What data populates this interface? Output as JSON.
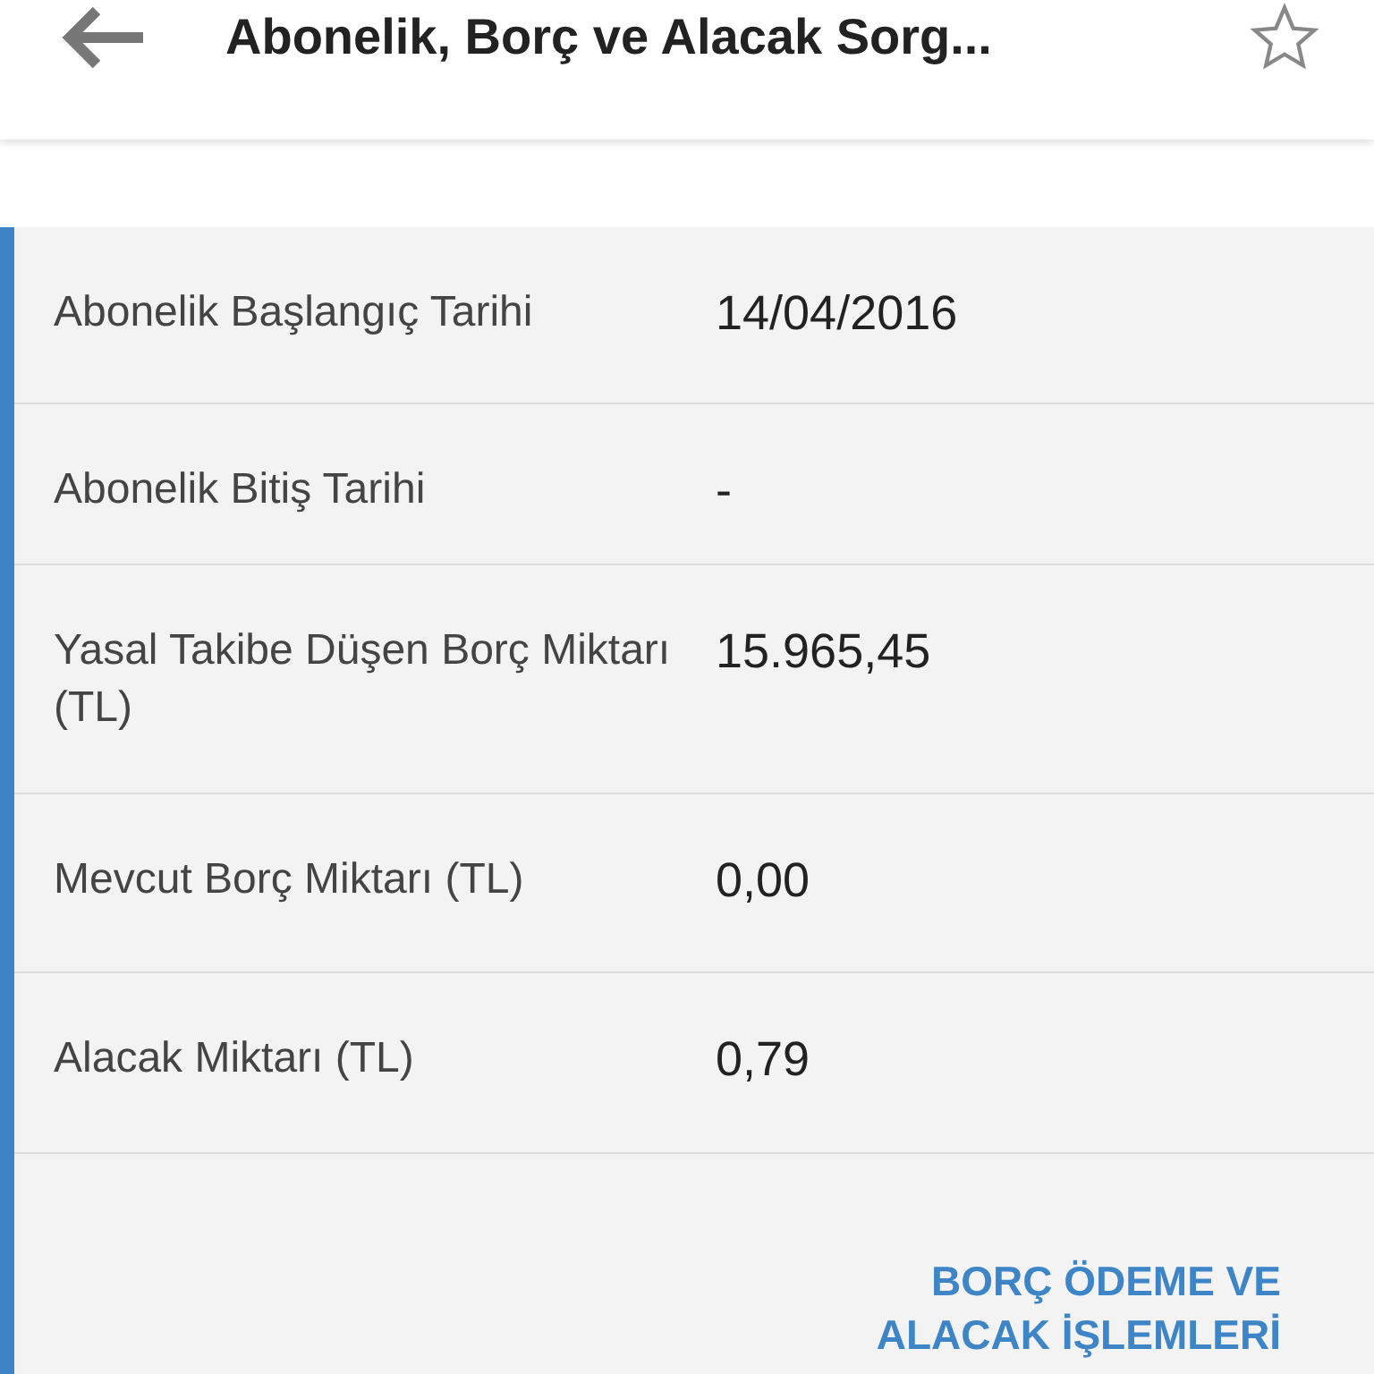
{
  "header": {
    "title": "Abonelik, Borç ve Alacak Sorg...",
    "starred": false
  },
  "rows": [
    {
      "label": "Abonelik Başlangıç Tarihi",
      "value": "14/04/2016"
    },
    {
      "label": "Abonelik Bitiş Tarihi",
      "value": "-"
    },
    {
      "label": "Yasal Takibe Düşen Borç Miktarı (TL)",
      "value": "15.965,45"
    },
    {
      "label": "Mevcut Borç Miktarı (TL)",
      "value": "0,00"
    },
    {
      "label": "Alacak Miktarı (TL)",
      "value": "0,79"
    }
  ],
  "action": {
    "label": "BORÇ ÖDEME VE ALACAK İŞLEMLERİ"
  }
}
